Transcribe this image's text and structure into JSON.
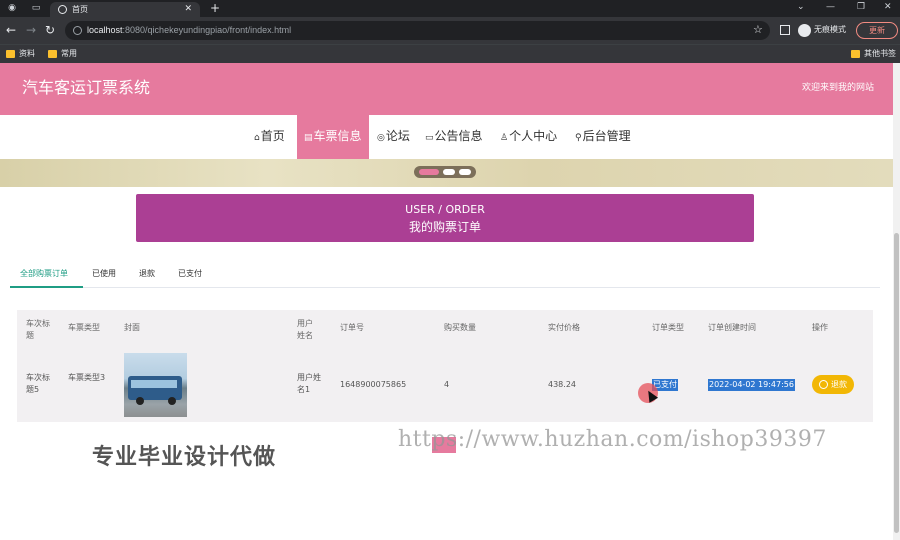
{
  "browser": {
    "tab_title": "首页",
    "url_host": "localhost",
    "url_rest": ":8080/qichekeyundingpiao/front/index.html",
    "incognito_label": "无痕模式",
    "update_label": "更新",
    "bookmarks": [
      "资料",
      "常用"
    ],
    "other_bookmarks": "其他书签"
  },
  "header": {
    "title": "汽车客运订票系统",
    "welcome": "欢迎来到我的网站"
  },
  "nav": {
    "items": [
      {
        "label": "首页",
        "icon": "home-icon"
      },
      {
        "label": "车票信息",
        "icon": "ticket-icon"
      },
      {
        "label": "论坛",
        "icon": "forum-icon"
      },
      {
        "label": "公告信息",
        "icon": "notice-icon"
      },
      {
        "label": "个人中心",
        "icon": "user-icon"
      },
      {
        "label": "后台管理",
        "icon": "link-icon"
      }
    ],
    "active_index": 1
  },
  "order_banner": {
    "en": "USER / ORDER",
    "zh": "我的购票订单"
  },
  "subtabs": [
    "全部购票订单",
    "已使用",
    "退款",
    "已支付"
  ],
  "table": {
    "headers": [
      "车次标题",
      "车票类型",
      "封面",
      "用户姓名",
      "订单号",
      "购买数量",
      "实付价格",
      "订单类型",
      "订单创建时间",
      "操作"
    ],
    "rows": [
      {
        "title": "车次标题5",
        "ticket_type": "车票类型3",
        "user_name": "用户姓名1",
        "order_no": "1648900075865",
        "quantity": "4",
        "price": "438.24",
        "order_type": "已支付",
        "created": "2022-04-02 19:47:56",
        "action": "退款"
      }
    ]
  },
  "watermark": {
    "left": "专业毕业设计代做",
    "url": "https://www.huzhan.com/ishop39397"
  },
  "colors": {
    "brand_pink": "#e67a9e",
    "banner_purple": "#ab3f94",
    "active_tab_green": "#1f9d84",
    "refund_yellow": "#f2b705"
  }
}
